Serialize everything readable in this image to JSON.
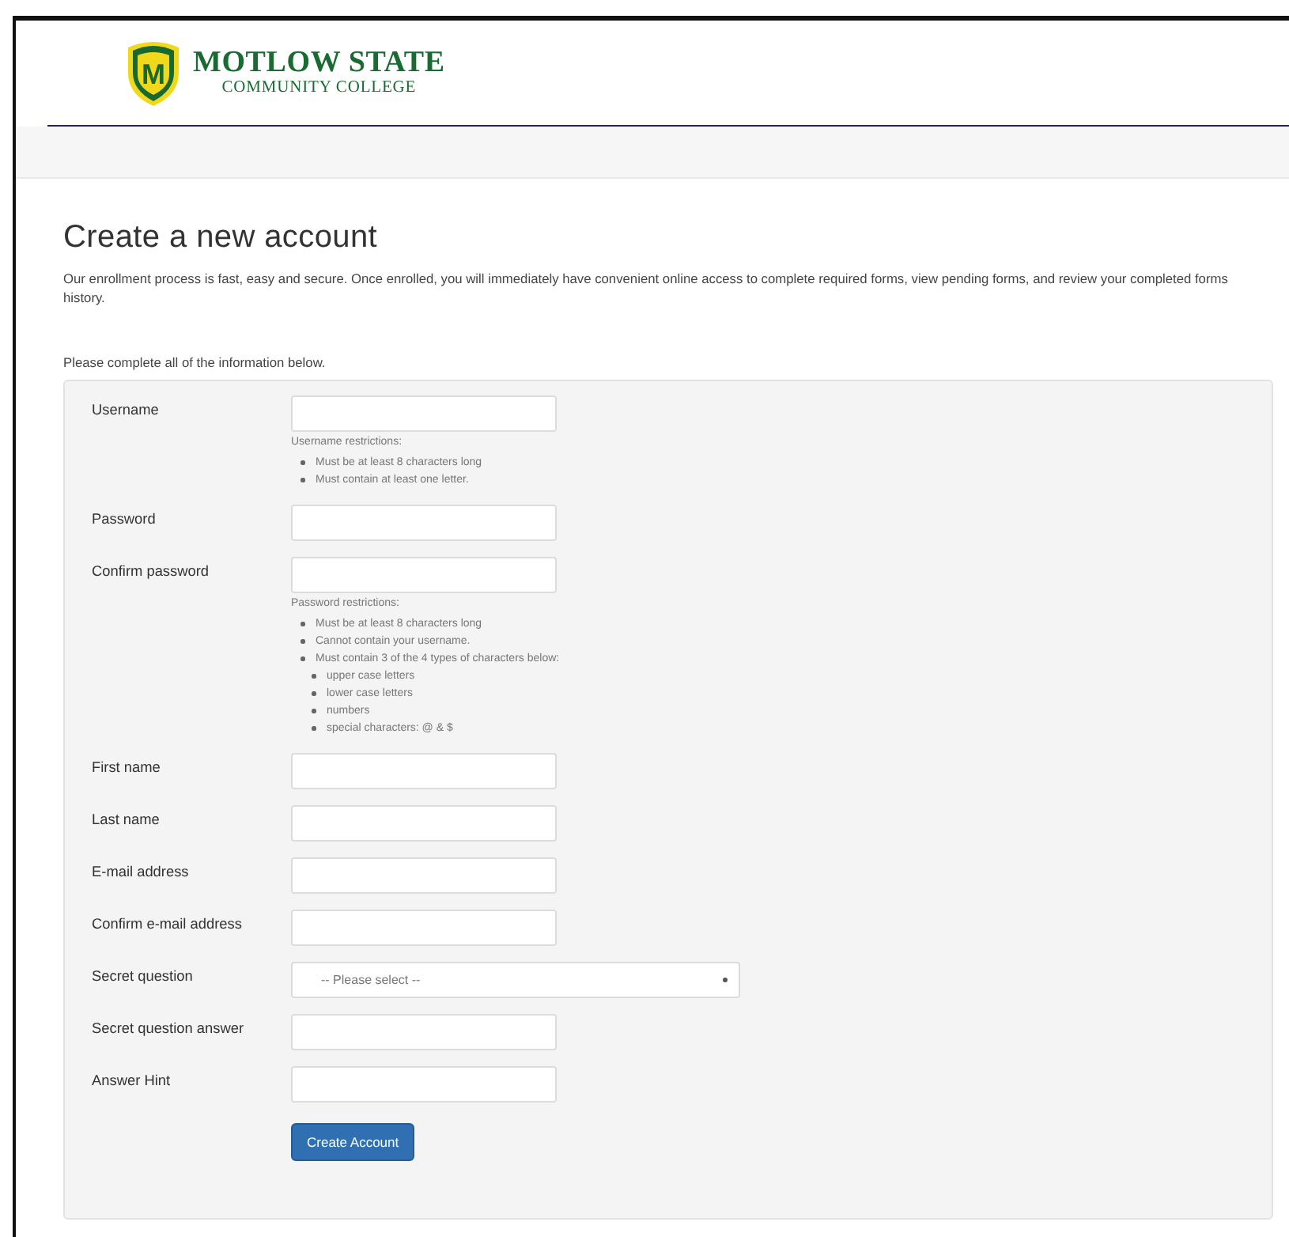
{
  "header": {
    "logo_mark": "M",
    "name": "MOTLOW STATE",
    "subtitle": "COMMUNITY COLLEGE"
  },
  "page": {
    "title": "Create a new account",
    "intro": "Our enrollment process is fast, easy and secure. Once enrolled, you will immediately have convenient online access to complete required forms, view pending forms, and review your completed forms history.",
    "instruction": "Please complete all of the information below."
  },
  "form": {
    "fields": [
      {
        "kind": "text",
        "label": "Username",
        "restrictions": {
          "title": "Username restrictions:",
          "items": [
            {
              "text": "Must be at least 8 characters long"
            },
            {
              "text": "Must contain at least one letter."
            }
          ]
        }
      },
      {
        "kind": "text",
        "label": "Password"
      },
      {
        "kind": "text",
        "label": "Confirm password",
        "restrictions": {
          "title": "Password restrictions:",
          "items": [
            {
              "text": "Must be at least 8 characters long"
            },
            {
              "text": "Cannot contain your username."
            },
            {
              "text": "Must contain 3 of the 4 types of characters below:",
              "children": [
                {
                  "text": "upper case letters"
                },
                {
                  "text": "lower case letters"
                },
                {
                  "text": "numbers"
                },
                {
                  "text": "special characters: @ & $"
                }
              ]
            }
          ]
        }
      },
      {
        "kind": "text",
        "label": "First name"
      },
      {
        "kind": "text",
        "label": "Last name"
      },
      {
        "kind": "text",
        "label": "E-mail address"
      },
      {
        "kind": "text",
        "label": "Confirm e-mail address"
      },
      {
        "kind": "select",
        "label": "Secret question",
        "value": "-- Please select --"
      },
      {
        "kind": "text",
        "label": "Secret question answer"
      },
      {
        "kind": "text",
        "label": "Answer Hint"
      }
    ],
    "submit": "Create Account"
  }
}
